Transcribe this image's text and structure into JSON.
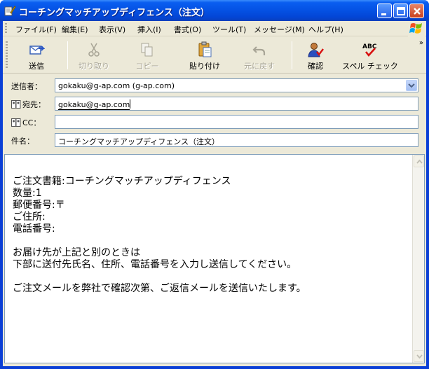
{
  "window": {
    "title": "コーチングマッチアップディフェンス（注文）"
  },
  "menu": {
    "items": [
      "ファイル(F)",
      "編集(E)",
      "表示(V)",
      "挿入(I)",
      "書式(O)",
      "ツール(T)",
      "メッセージ(M)",
      "ヘルプ(H)"
    ]
  },
  "toolbar": {
    "send": "送信",
    "cut": "切り取り",
    "copy": "コピー",
    "paste": "貼り付け",
    "undo": "元に戻す",
    "check": "確認",
    "spell": "スペル チェック",
    "spell_icon_text": "ABC"
  },
  "fields": {
    "from_label": "送信者：",
    "from_value": "gokaku@g-ap.com    (g-ap.com)",
    "to_label": "宛先：",
    "to_value": "gokaku@g-ap.com",
    "cc_label": "CC：",
    "cc_value": "",
    "subject_label": "件名：",
    "subject_value": "コーチングマッチアップディフェンス（注文）"
  },
  "message": {
    "body": "ご注文書籍:コーチングマッチアップディフェンス\n数量:1\n郵便番号:〒\nご住所:\n電話番号:\n\nお届け先が上記と別のときは\n下部に送付先氏名、住所、電話番号を入力し送信してください。\n\nご注文メールを弊社で確認次第、ご返信メールを送信いたします。"
  },
  "colors": {
    "titlebar": "#0553e5",
    "face": "#ece9d8",
    "field_border": "#7f9db9"
  }
}
